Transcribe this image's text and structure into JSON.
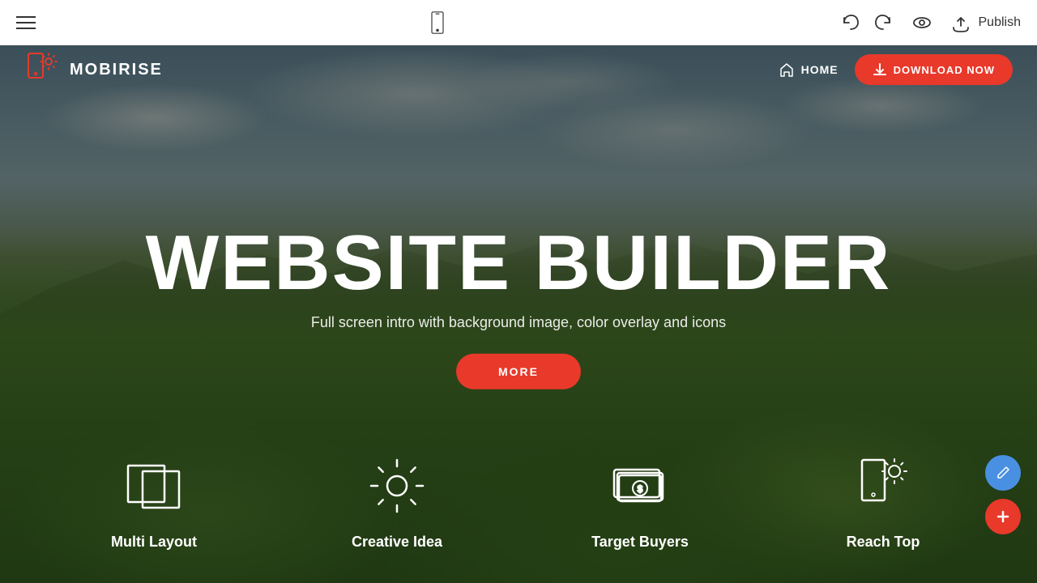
{
  "toolbar": {
    "publish_label": "Publish"
  },
  "nav": {
    "logo_text": "MOBIRISE",
    "home_label": "HOME",
    "download_label": "DOWNLOAD NOW"
  },
  "hero": {
    "title": "WEBSITE BUILDER",
    "subtitle": "Full screen intro with background image, color overlay and icons",
    "more_label": "MORE"
  },
  "features": [
    {
      "id": "multi-layout",
      "label": "Multi Layout",
      "icon": "layout"
    },
    {
      "id": "creative-idea",
      "label": "Creative Idea",
      "icon": "idea"
    },
    {
      "id": "target-buyers",
      "label": "Target Buyers",
      "icon": "money"
    },
    {
      "id": "reach-top",
      "label": "Reach Top",
      "icon": "mobile-sun"
    }
  ],
  "colors": {
    "accent": "#e8392a",
    "fab_blue": "#4a90e2"
  }
}
